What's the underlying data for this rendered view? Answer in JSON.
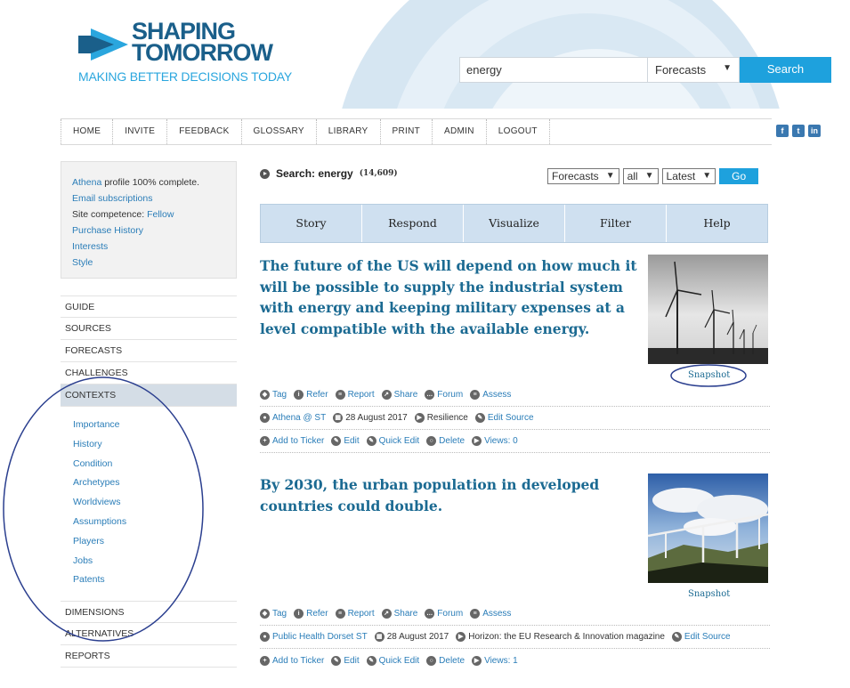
{
  "logo": {
    "line1": "SHAPING",
    "line2": "TOMORROW",
    "tagline": "MAKING BETTER DECISIONS TODAY"
  },
  "search": {
    "value": "energy",
    "category": "Forecasts",
    "button": "Search"
  },
  "topnav": [
    "HOME",
    "INVITE",
    "FEEDBACK",
    "GLOSSARY",
    "LIBRARY",
    "PRINT",
    "ADMIN",
    "LOGOUT"
  ],
  "social": [
    "facebook-icon",
    "twitter-icon",
    "linkedin-icon"
  ],
  "profile": {
    "user": "Athena",
    "complete_text": "profile 100% complete.",
    "email_subscriptions": "Email subscriptions",
    "competence_label": "Site competence:",
    "competence_value": "Fellow",
    "purchase_history": "Purchase History",
    "interests": "Interests",
    "style": "Style"
  },
  "leftmenu": {
    "top": [
      "GUIDE",
      "SOURCES",
      "FORECASTS",
      "CHALLENGES"
    ],
    "active": "CONTEXTS",
    "submenu": [
      "Importance",
      "History",
      "Condition",
      "Archetypes",
      "Worldviews",
      "Assumptions",
      "Players",
      "Jobs",
      "Patents"
    ],
    "bottom": [
      "DIMENSIONS",
      "ALTERNATIVES",
      "REPORTS"
    ]
  },
  "results": {
    "title": "Search: energy",
    "count": "(14,609)",
    "filter_type": "Forecasts",
    "filter_scope": "all",
    "filter_sort": "Latest",
    "go": "Go"
  },
  "tabs": [
    "Story",
    "Respond",
    "Visualize",
    "Filter",
    "Help"
  ],
  "actions": {
    "tag": "Tag",
    "refer": "Refer",
    "report": "Report",
    "share": "Share",
    "forum": "Forum",
    "assess": "Assess",
    "add_ticker": "Add to Ticker",
    "edit": "Edit",
    "quick_edit": "Quick Edit",
    "delete": "Delete",
    "edit_source": "Edit Source",
    "snapshot": "Snapshot"
  },
  "articles": [
    {
      "title": "The future of the US will depend on how much it will be possible to supply the industrial system with energy and keeping military expenses at a level compatible with the available energy.",
      "author": "Athena @ ST",
      "date": "28 August 2017",
      "source": "Resilience",
      "views": "Views: 0"
    },
    {
      "title": "By 2030, the urban population in developed countries could double.",
      "author": "Public Health Dorset ST",
      "date": "28 August 2017",
      "source": "Horizon: the EU Research & Innovation magazine",
      "views": "Views: 1"
    }
  ],
  "colors": {
    "brand": "#1a5f8a",
    "accent": "#1ea1dd",
    "link": "#2a7db8",
    "title": "#1b6a92",
    "annotation": "#2b3f8f"
  }
}
